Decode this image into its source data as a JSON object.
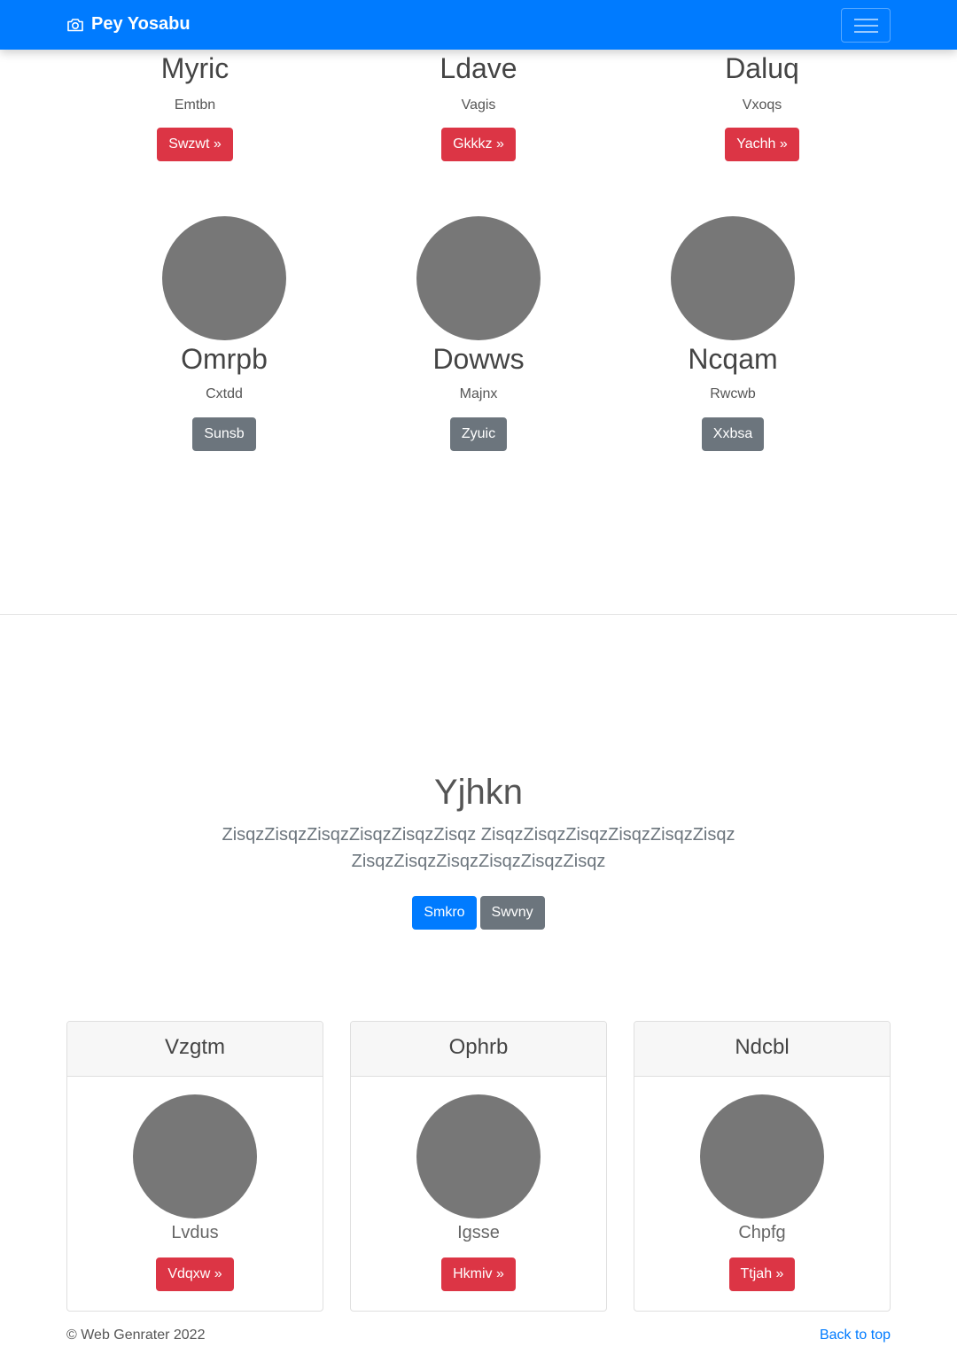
{
  "navbar": {
    "brand": "Pey Yosabu",
    "brand_icon": "camera-icon",
    "toggler_icon": "hamburger-menu-icon",
    "color": "#007bff"
  },
  "top_row": [
    {
      "title": "Myric",
      "text": "Emtbn",
      "button": "Swzwt »"
    },
    {
      "title": "Ldave",
      "text": "Vagis",
      "button": "Gkkkz »"
    },
    {
      "title": "Daluq",
      "text": "Vxoqs",
      "button": "Yachh »"
    }
  ],
  "circle_row": [
    {
      "title": "Omrpb",
      "text": "Cxtdd",
      "button": "Sunsb"
    },
    {
      "title": "Dowws",
      "text": "Majnx",
      "button": "Zyuic"
    },
    {
      "title": "Ncqam",
      "text": "Rwcwb",
      "button": "Xxbsa"
    }
  ],
  "jumbotron": {
    "title": "Yjhkn",
    "lead": "ZisqzZisqzZisqzZisqzZisqzZisqz ZisqzZisqzZisqzZisqzZisqzZisqz ZisqzZisqzZisqzZisqzZisqzZisqz",
    "primary_button": "Smkro",
    "secondary_button": "Swvny"
  },
  "cards": [
    {
      "header": "Vzgtm",
      "text": "Lvdus",
      "button": "Vdqxw »"
    },
    {
      "header": "Ophrb",
      "text": "Igsse",
      "button": "Hkmiv »"
    },
    {
      "header": "Ndcbl",
      "text": "Chpfg",
      "button": "Ttjah »"
    }
  ],
  "footer": {
    "copyright": "© Web Genrater 2022",
    "back_to_top": "Back to top"
  }
}
